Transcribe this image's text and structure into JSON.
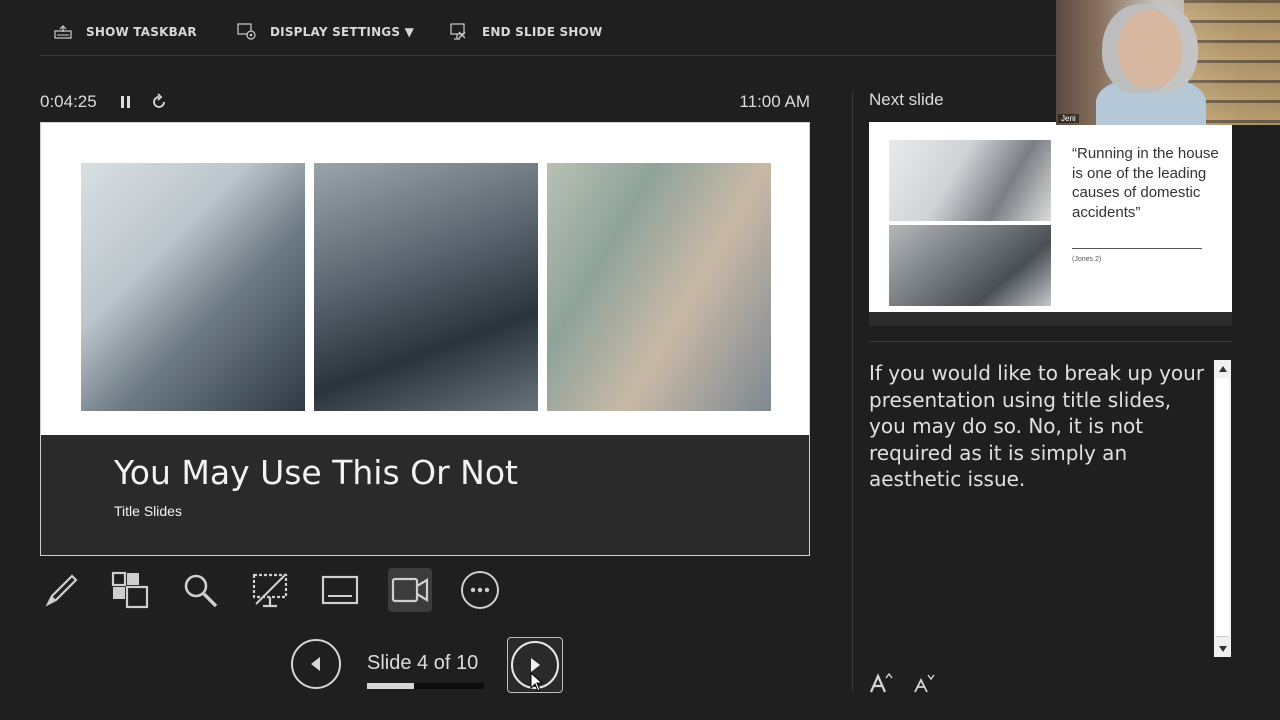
{
  "toolbar": {
    "show_taskbar": "SHOW TASKBAR",
    "display_settings": "DISPLAY SETTINGS ▼",
    "end_slide_show": "END SLIDE SHOW"
  },
  "timer": {
    "elapsed": "0:04:25",
    "clock": "11:00 AM"
  },
  "current_slide": {
    "title": "You May Use This Or Not",
    "subtitle": "Title Slides"
  },
  "tools": [
    "pen-icon",
    "all-slides-icon",
    "zoom-icon",
    "black-screen-icon",
    "subtitles-icon",
    "camera-icon",
    "more-options-icon"
  ],
  "navigation": {
    "counter": "Slide 4 of 10",
    "current": 4,
    "total": 10,
    "progress_fraction": 0.4
  },
  "next_slide": {
    "label": "Next slide",
    "quote": "“Running in the house is one of the leading causes of domestic accidents”",
    "citation": "(Jones 2)"
  },
  "notes": {
    "text": "If you would like to break up your presentation using title slides, you may do so. No, it is not required as it is simply an aesthetic issue."
  },
  "video": {
    "name": "Jeni"
  },
  "colors": {
    "background": "#1f1f1f",
    "band": "#2a2a2a",
    "text": "#e6e6e6"
  }
}
